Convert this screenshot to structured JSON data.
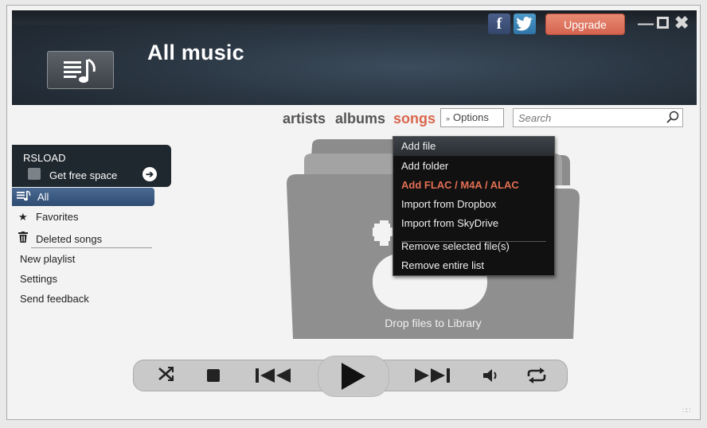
{
  "header": {
    "title": "All music",
    "upgrade_label": "Upgrade",
    "facebook_glyph": "f",
    "twitter_glyph": "t"
  },
  "nav": {
    "tabs": [
      {
        "label": "artists",
        "active": false
      },
      {
        "label": "albums",
        "active": false
      },
      {
        "label": "songs",
        "active": true
      }
    ],
    "options_label": "Options",
    "search_placeholder": "Search"
  },
  "sidebar": {
    "rsload": {
      "title": "RSLOAD",
      "action_label": "Get free space"
    },
    "items": [
      {
        "label": "All",
        "icon": "playlist-icon",
        "selected": true
      },
      {
        "label": "Favorites",
        "icon": "star-icon"
      },
      {
        "label": "Deleted songs",
        "icon": "trash-icon"
      },
      {
        "label": "New playlist"
      },
      {
        "label": "Settings"
      },
      {
        "label": "Send feedback"
      }
    ]
  },
  "options_menu": {
    "items": [
      {
        "label": "Add file",
        "highlighted": true
      },
      {
        "label": "Add folder"
      },
      {
        "label": "Add FLAC / M4A / ALAC",
        "accent": true
      },
      {
        "label": "Import from Dropbox"
      },
      {
        "label": "Import from SkyDrive"
      },
      {
        "label": "Remove selected file(s)"
      },
      {
        "label": "Remove entire list"
      }
    ]
  },
  "library": {
    "drop_text": "Drop files to Library"
  },
  "player": {
    "controls": [
      "shuffle-icon",
      "stop-icon",
      "previous-icon",
      "play-icon",
      "next-icon",
      "volume-icon",
      "repeat-icon"
    ]
  },
  "colors": {
    "accent": "#d9664d",
    "header_bg": "#2a3642",
    "selected_item": "#3b5a83",
    "menu_bg": "#111111"
  }
}
